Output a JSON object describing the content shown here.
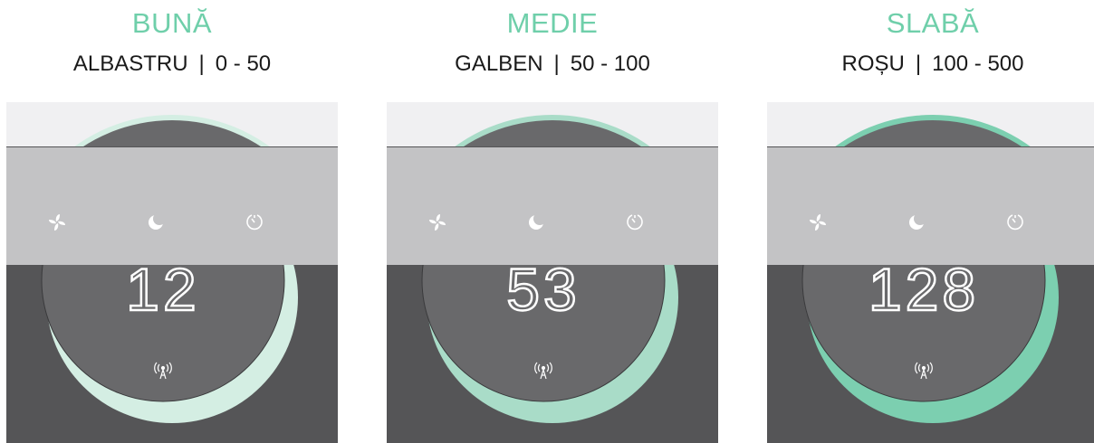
{
  "panels": [
    {
      "heading": "BUNĂ",
      "color_name": "ALBASTRU",
      "separator": "|",
      "range": "0 - 50",
      "display_value": "12",
      "ring_color": "#d4eee3",
      "icons": [
        "fan-icon",
        "moon-icon",
        "timer-icon",
        "wifi-antenna-icon"
      ]
    },
    {
      "heading": "MEDIE",
      "color_name": "GALBEN",
      "separator": "|",
      "range": "50 - 100",
      "display_value": "53",
      "ring_color": "#a9dcc8",
      "icons": [
        "fan-icon",
        "moon-icon",
        "timer-icon",
        "wifi-antenna-icon"
      ]
    },
    {
      "heading": "SLABĂ",
      "color_name": "ROȘU",
      "separator": "|",
      "range": "100 - 500",
      "display_value": "128",
      "ring_color": "#7ccfb0",
      "icons": [
        "fan-icon",
        "moon-icon",
        "timer-icon",
        "wifi-antenna-icon"
      ]
    }
  ],
  "colors": {
    "heading": "#6fcfaa",
    "top_band": "#f0f0f2",
    "middle_band": "#c3c3c5",
    "bottom_band": "#555557",
    "dial": "#69696b",
    "digits": "#ffffff"
  }
}
